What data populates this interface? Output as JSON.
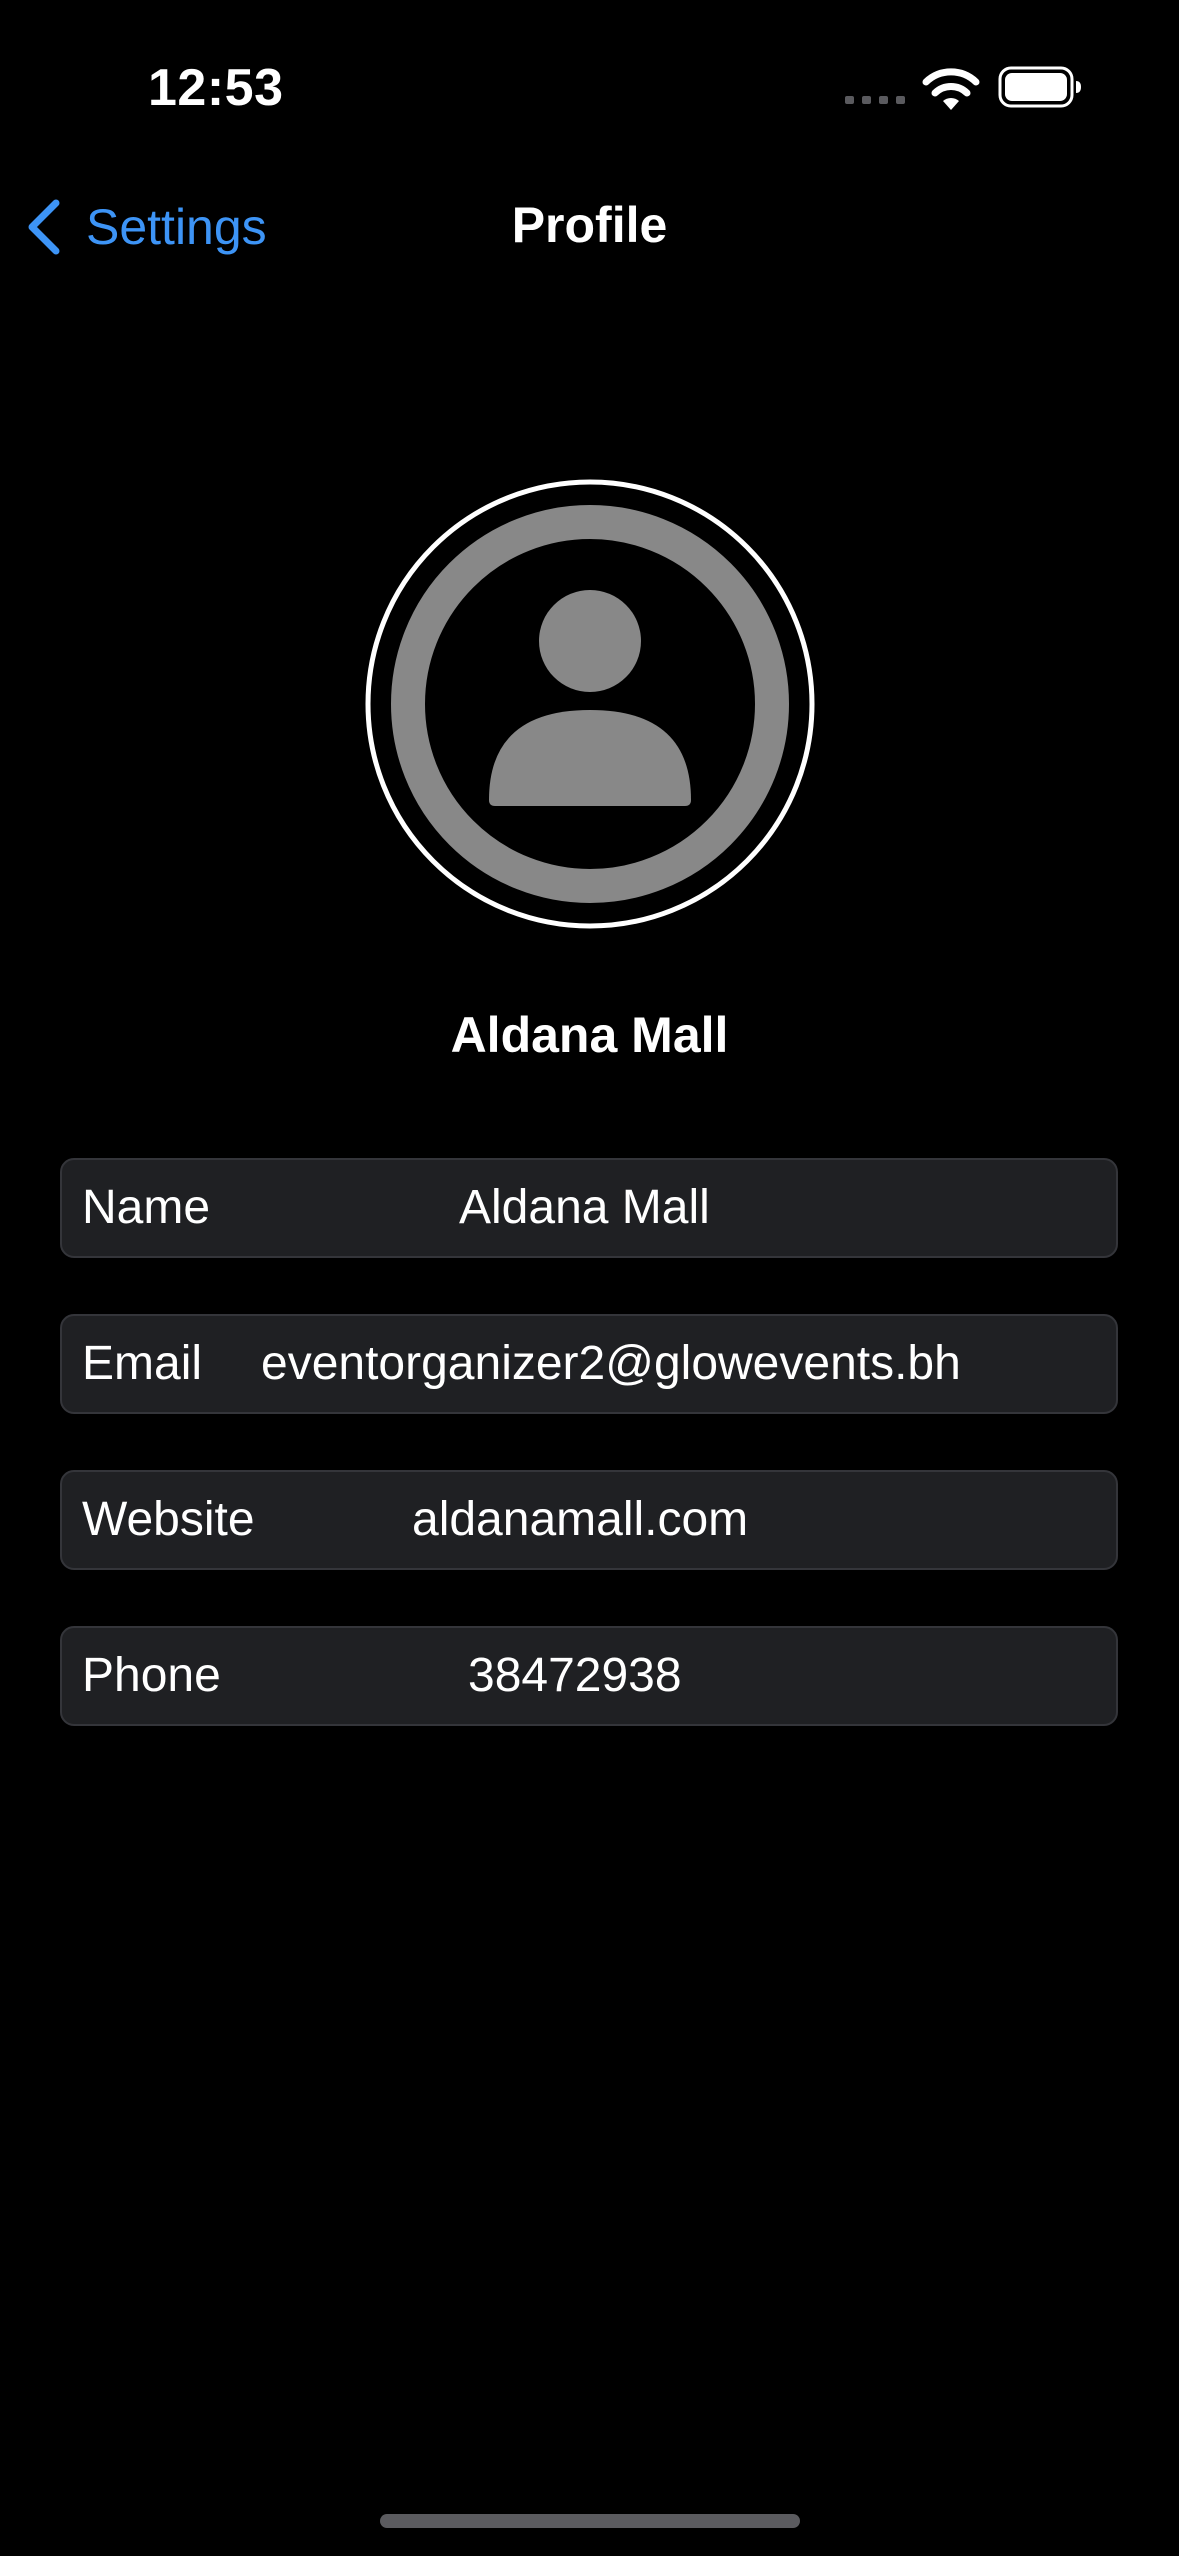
{
  "status_bar": {
    "time": "12:53",
    "icons": [
      "signal-dots-icon",
      "wifi-icon",
      "battery-icon"
    ]
  },
  "nav": {
    "back_label": "Settings",
    "back_icon": "chevron-left-icon",
    "title": "Profile"
  },
  "profile": {
    "avatar_icon": "person-avatar-icon",
    "name": "Aldana Mall"
  },
  "fields": [
    {
      "label": "Name",
      "value": "Aldana Mall"
    },
    {
      "label": "Email",
      "value": "eventorganizer2@glowevents.bh"
    },
    {
      "label": "Website",
      "value": "aldanamall.com"
    },
    {
      "label": "Phone",
      "value": "38472938"
    }
  ],
  "colors": {
    "background": "#000000",
    "accent": "#3d94f6",
    "row_background": "#1f2023",
    "row_border": "#34353a",
    "avatar_gray": "#888888",
    "text": "#ffffff"
  }
}
